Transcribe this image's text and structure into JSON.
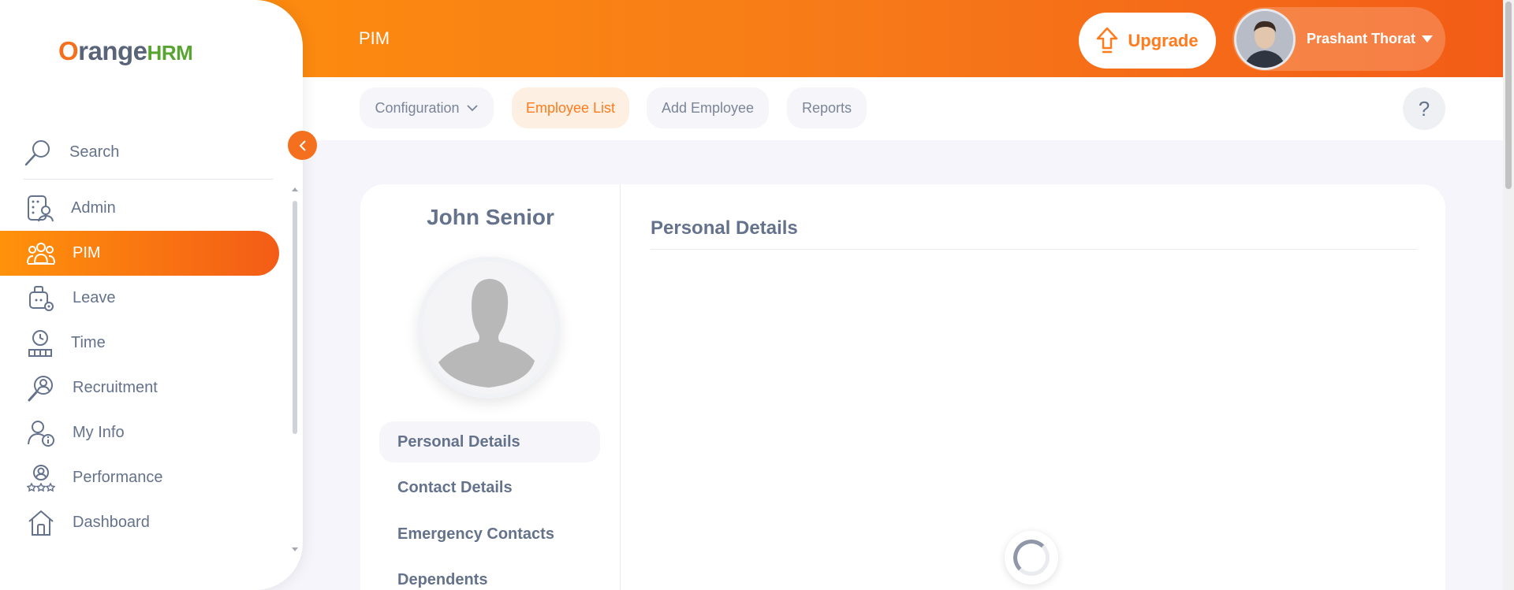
{
  "header": {
    "module_title": "PIM",
    "upgrade_label": "Upgrade",
    "user_name": "Prashant Thorat",
    "help_label": "?"
  },
  "subnav": {
    "tabs": [
      {
        "label": "Configuration",
        "dropdown": true
      },
      {
        "label": "Employee List",
        "active": true
      },
      {
        "label": "Add Employee"
      },
      {
        "label": "Reports"
      }
    ]
  },
  "sidebar": {
    "logo_o": "O",
    "logo_range": "range",
    "logo_hrm": "HRM",
    "search_label": "Search",
    "items": [
      {
        "label": "Admin",
        "icon": "admin-icon"
      },
      {
        "label": "PIM",
        "icon": "pim-icon",
        "active": true
      },
      {
        "label": "Leave",
        "icon": "leave-icon"
      },
      {
        "label": "Time",
        "icon": "time-icon"
      },
      {
        "label": "Recruitment",
        "icon": "recruitment-icon"
      },
      {
        "label": "My Info",
        "icon": "my-info-icon"
      },
      {
        "label": "Performance",
        "icon": "performance-icon"
      },
      {
        "label": "Dashboard",
        "icon": "dashboard-icon"
      }
    ]
  },
  "employee": {
    "name": "John Senior",
    "menu": [
      {
        "label": "Personal Details",
        "active": true
      },
      {
        "label": "Contact Details"
      },
      {
        "label": "Emergency Contacts"
      },
      {
        "label": "Dependents"
      }
    ]
  },
  "content": {
    "section_title": "Personal Details"
  },
  "colors": {
    "accent": "#ff7b1d",
    "header_start": "#ff920b",
    "header_end": "#f35c17",
    "text": "#64728c"
  }
}
